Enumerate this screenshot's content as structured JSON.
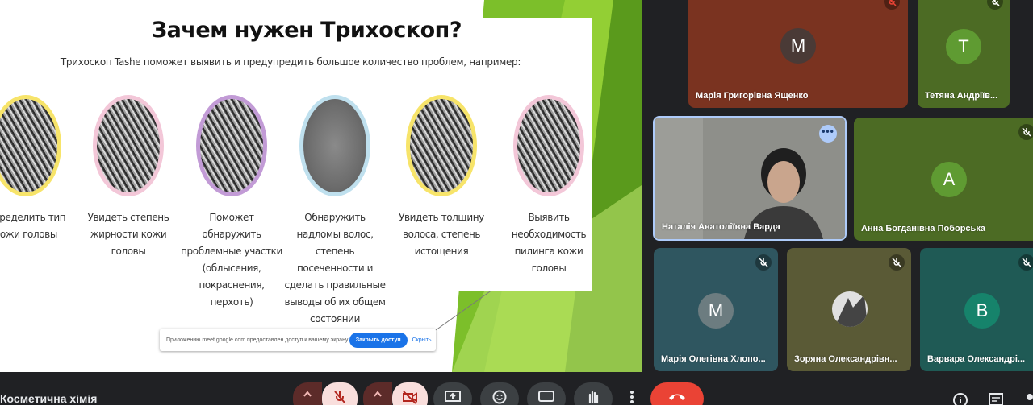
{
  "slide": {
    "title": "Зачем нужен Трихоскоп?",
    "subtitle": "Трихоскоп Tashe поможет выявить и предупредить большое количество проблем, например:",
    "features": [
      {
        "caption": "Определить тип кожи головы",
        "ring": "#f7e46a"
      },
      {
        "caption": "Увидеть степень жирности кожи головы",
        "ring": "#f3c7d8"
      },
      {
        "caption": "Поможет обнаружить проблемные участки (облысения, покраснения, перхоть)",
        "ring": "#c29bd6"
      },
      {
        "caption": "Обнаружить надломы волос, степень посеченности и сделать правильные выводы об их общем состоянии",
        "ring": "#bfe0ee"
      },
      {
        "caption": "Увидеть толщину волоса, степень истощения",
        "ring": "#f7e46a"
      },
      {
        "caption": "Выявить необходимость пилинга кожи головы",
        "ring": "#f3c7d8"
      }
    ]
  },
  "notification": {
    "text": "Приложению meet.google.com предоставлен доступ к вашему экрану.",
    "button": "Закрыть доступ",
    "link": "Скрыть"
  },
  "participants": [
    {
      "name": "Марія Григорівна Ященко",
      "initial": "М",
      "bg": "#7a3320",
      "avatar": "#4a3a36",
      "muted": true
    },
    {
      "name": "Тетяна Андріїв...",
      "initial": "Т",
      "bg": "#4c6b24",
      "avatar": "#5f9b32",
      "muted": true
    },
    {
      "name": "Наталія Анатоліївна Варда",
      "initial": "",
      "bg": "#8e8f8a",
      "avatar": "",
      "muted": false
    },
    {
      "name": "Анна Богданівна Поборська",
      "initial": "А",
      "bg": "#4c6b24",
      "avatar": "#5f9b32",
      "muted": true
    },
    {
      "name": "Марія Олегівна Хлопо...",
      "initial": "М",
      "bg": "#2f5660",
      "avatar": "#6c7c80",
      "muted": true
    },
    {
      "name": "Зоряна Олександрівн...",
      "initial": "",
      "bg": "#5a5a36",
      "avatar": "",
      "muted": true
    },
    {
      "name": "Варвара Олександрі...",
      "initial": "В",
      "bg": "#1f5a55",
      "avatar": "#16836b",
      "muted": true
    }
  ],
  "meeting": {
    "name": "Косметична хімія"
  },
  "colors": {
    "accent": "#1a73e8",
    "danger": "#ea4335",
    "bar": "#202124"
  }
}
